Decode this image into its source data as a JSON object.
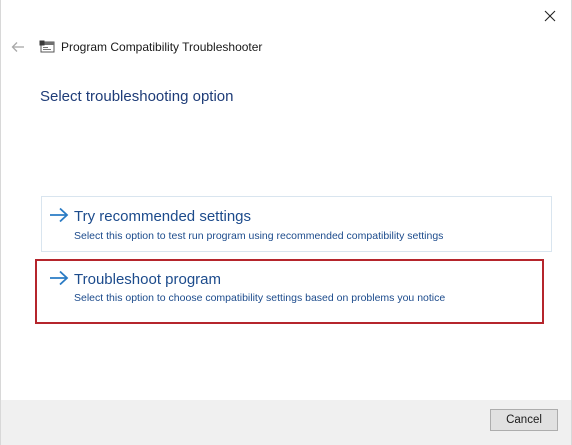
{
  "window": {
    "title": "Program Compatibility Troubleshooter"
  },
  "page": {
    "heading": "Select troubleshooting option"
  },
  "options": [
    {
      "title": "Try recommended settings",
      "description": "Select this option to test run program using recommended compatibility settings"
    },
    {
      "title": "Troubleshoot program",
      "description": "Select this option to choose compatibility settings based on problems you notice"
    }
  ],
  "footer": {
    "cancel_label": "Cancel"
  },
  "colors": {
    "link_blue": "#1c4b8c",
    "heading_blue": "#1e3c78",
    "arrow_teal": "#2a7bc4",
    "highlight_red": "#b5252c",
    "footer_bg": "#f0f0f0"
  },
  "icons": {
    "close": "close-icon",
    "back": "back-arrow-icon",
    "app": "troubleshooter-icon",
    "option_arrow": "arrow-right-icon"
  }
}
